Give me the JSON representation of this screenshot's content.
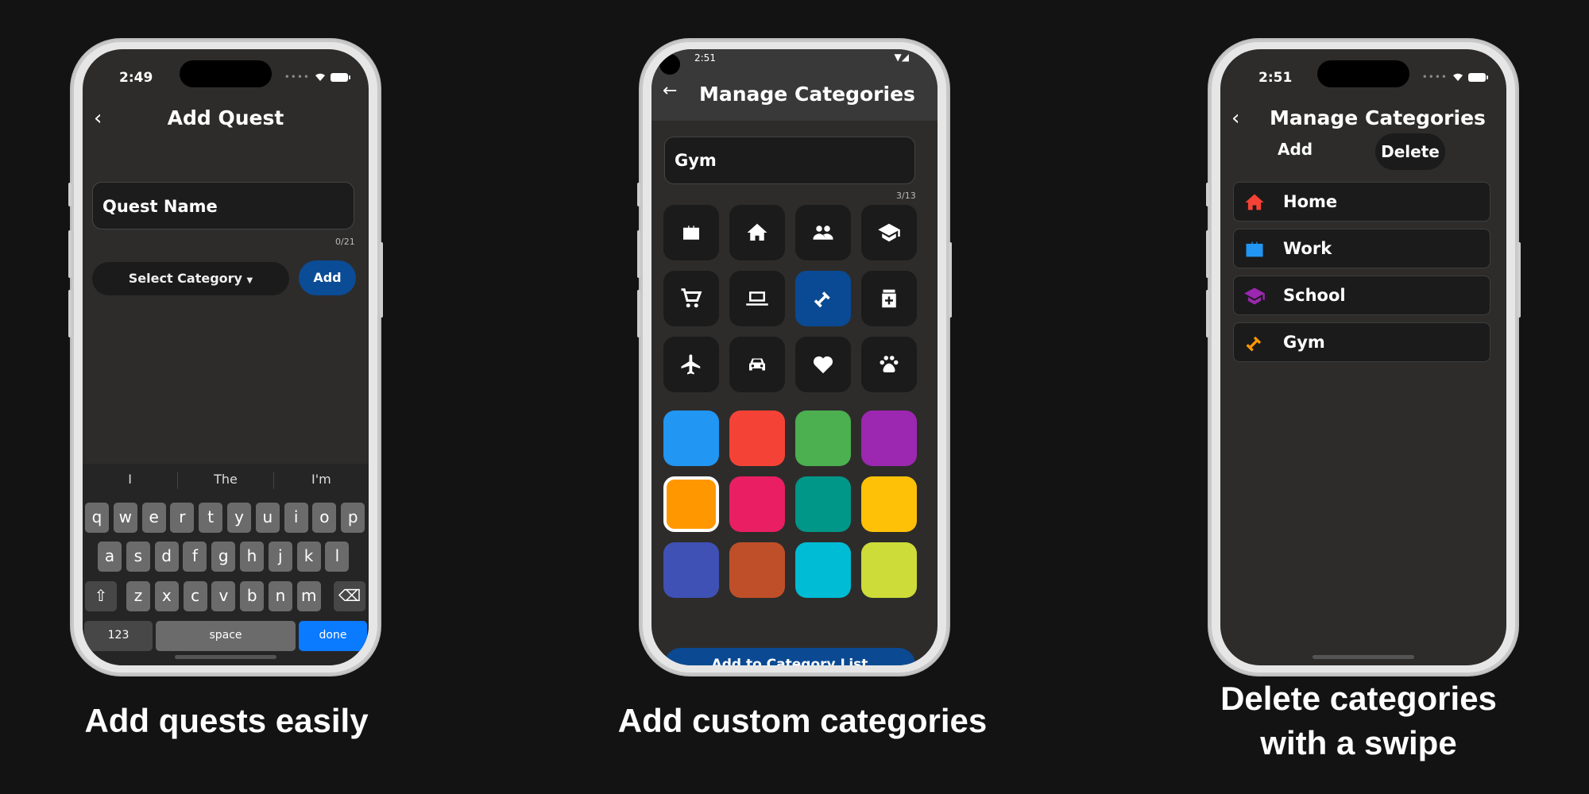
{
  "phone1": {
    "time": "2:49",
    "title": "Add Quest",
    "quest_name_placeholder": "Quest Name",
    "counter": "0/21",
    "select_category": "Select Category",
    "add": "Add",
    "suggestions": [
      "I",
      "The",
      "I'm"
    ],
    "keys_row1": [
      "q",
      "w",
      "e",
      "r",
      "t",
      "y",
      "u",
      "i",
      "o",
      "p"
    ],
    "keys_row2": [
      "a",
      "s",
      "d",
      "f",
      "g",
      "h",
      "j",
      "k",
      "l"
    ],
    "keys_row3": [
      "z",
      "x",
      "c",
      "v",
      "b",
      "n",
      "m"
    ],
    "key_123": "123",
    "key_space": "space",
    "key_done": "done"
  },
  "phone2": {
    "time": "2:51",
    "title": "Manage Categories",
    "input_value": "Gym",
    "counter": "3/13",
    "icons": [
      "briefcase-icon",
      "home-icon",
      "people-icon",
      "school-icon",
      "cart-icon",
      "laptop-icon",
      "dumbbell-icon",
      "medicine-icon",
      "airplane-icon",
      "car-icon",
      "heart-icon",
      "paw-icon"
    ],
    "selected_icon": "dumbbell-icon",
    "colors": [
      "#2196f3",
      "#f44336",
      "#4caf50",
      "#9c27b0",
      "#ff9800",
      "#e91e63",
      "#009688",
      "#ffc107",
      "#3f51b5",
      "#bf4f29",
      "#00bcd4",
      "#cddc39"
    ],
    "selected_color": "#ff9800",
    "add_to_list": "Add to Category List"
  },
  "phone3": {
    "time": "2:51",
    "title": "Manage Categories",
    "tab_add": "Add",
    "tab_delete": "Delete",
    "categories": [
      {
        "label": "Home",
        "icon": "home-icon",
        "color": "#f44336"
      },
      {
        "label": "Work",
        "icon": "briefcase-icon",
        "color": "#2196f3"
      },
      {
        "label": "School",
        "icon": "school-icon",
        "color": "#9c27b0"
      },
      {
        "label": "Gym",
        "icon": "dumbbell-icon",
        "color": "#ff9800"
      }
    ]
  },
  "captions": {
    "one": "Add quests easily",
    "two": "Add custom categories",
    "three_line1": "Delete categories",
    "three_line2": "with a swipe"
  }
}
